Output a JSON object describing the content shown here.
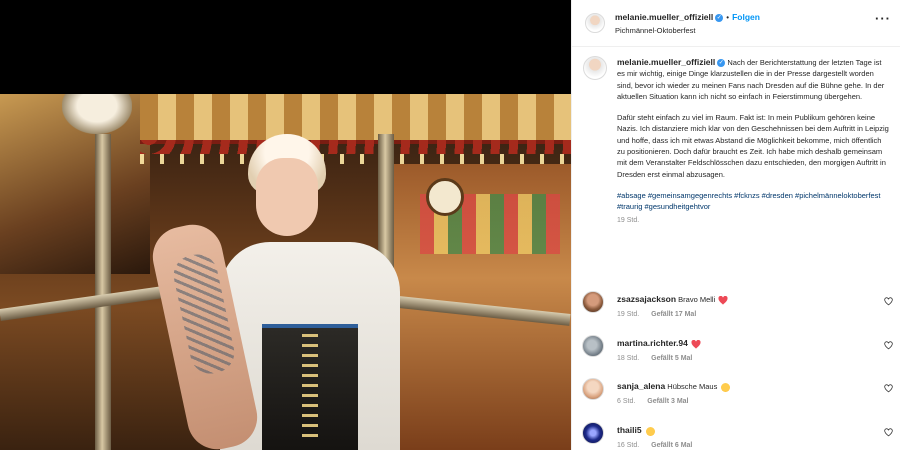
{
  "post": {
    "username": "melanie.mueller_offiziell",
    "follow_label": "Folgen",
    "location": "Pichmännel-Oktoberfest",
    "caption_username": "melanie.mueller_offiziell",
    "caption_p1": "Nach der Berichterstattung der letzten Tage ist es mir wichtig, einige Dinge klarzustellen die in der Presse dargestellt worden sind, bevor ich wieder zu meinen Fans nach Dresden auf die Bühne gehe. In der aktuellen Situation kann ich nicht so einfach in Feierstimmung übergehen.",
    "caption_p2": "Dafür steht einfach zu viel im Raum. Fakt ist: In mein Publikum gehören keine Nazis. Ich distanziere mich klar von den Geschehnissen bei dem Auftritt in Leipzig und hoffe, dass ich mit etwas Abstand die Möglichkeit bekomme, mich öffentlich zu positionieren. Doch dafür braucht es Zeit. Ich habe mich deshalb gemeinsam mit dem Veranstalter Feldschlösschen dazu entschieden, den morgigen Auftritt in Dresden erst einmal abzusagen.",
    "hashtags": "#absage #gemeinsamgegenrechts #fcknzs #dresden #pichelmännel­oktoberfest #traurig #gesundheitgehtvor",
    "caption_time": "19 Std."
  },
  "comments": [
    {
      "username": "zsazsajackson",
      "text": "Bravo Melli",
      "emoji": "red-heart",
      "time": "19 Std.",
      "likes": "Gefällt 17 Mal"
    },
    {
      "username": "martina.richter.94",
      "text": "",
      "emoji": "red-heart",
      "time": "18 Std.",
      "likes": "Gefällt 5 Mal"
    },
    {
      "username": "sanja_alena",
      "text": "Hübsche Maus",
      "emoji": "heart-eyes",
      "time": "6 Std.",
      "likes": "Gefällt 3 Mal"
    },
    {
      "username": "thaili5",
      "text": "",
      "emoji": "smiling-face",
      "time": "16 Std.",
      "likes": "Gefällt 6 Mal"
    }
  ],
  "icons": {
    "verified": "verified-badge-icon",
    "more": "more-options-icon",
    "like": "heart-outline-icon"
  },
  "colors": {
    "link": "#0095f6",
    "hashtag": "#00376b",
    "verified": "#3897f0",
    "heart": "#ed4956"
  }
}
